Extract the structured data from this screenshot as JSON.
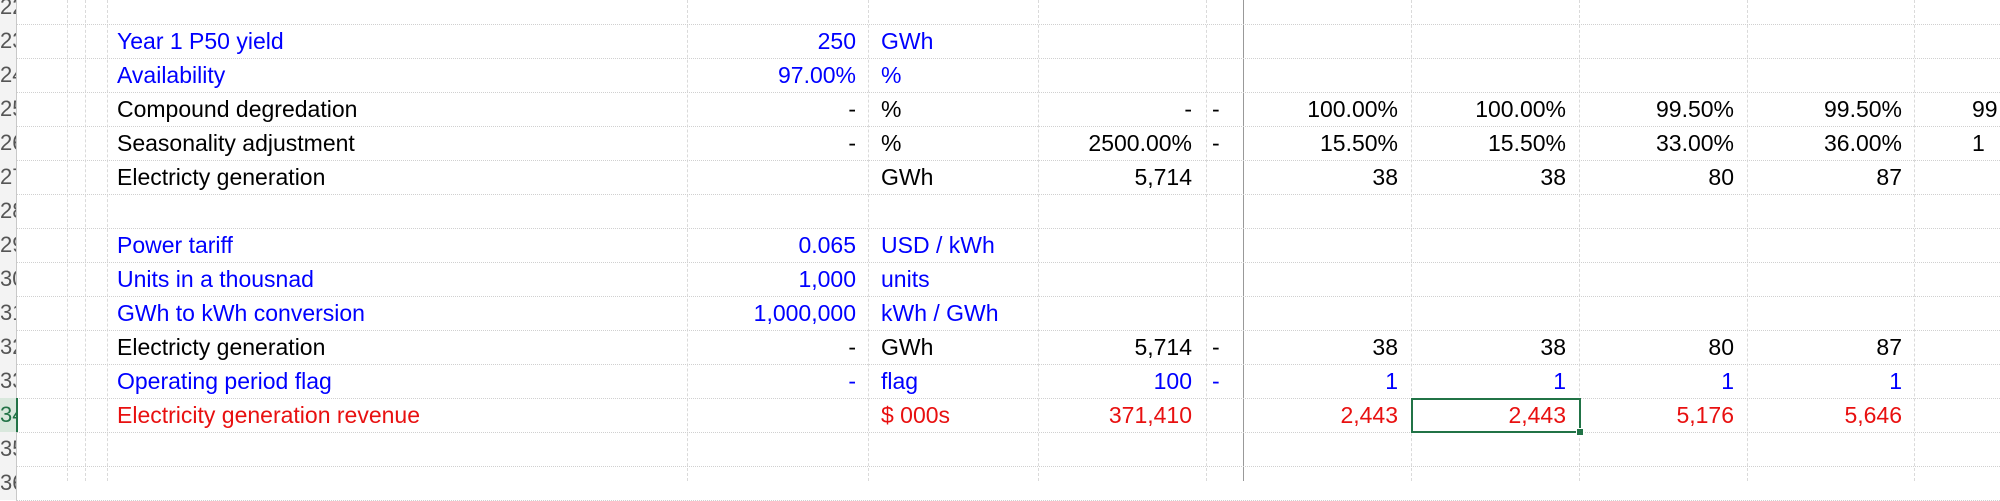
{
  "row_numbers": [
    "22",
    "23",
    "24",
    "25",
    "26",
    "27",
    "28",
    "29",
    "30",
    "31",
    "32",
    "33",
    "34",
    "35",
    "36"
  ],
  "active_row": "34",
  "rows": [
    {
      "row": "23",
      "color": "blue",
      "label": "Year 1 P50 yield",
      "value": "250",
      "unit": "GWh",
      "total": "",
      "flag": "",
      "periods": [
        "",
        "",
        "",
        ""
      ],
      "partial": ""
    },
    {
      "row": "24",
      "color": "blue",
      "label": "Availability",
      "value": "97.00%",
      "unit": "%",
      "total": "",
      "flag": "",
      "periods": [
        "",
        "",
        "",
        ""
      ],
      "partial": ""
    },
    {
      "row": "25",
      "color": "black",
      "label": "Compound degredation",
      "value": "-",
      "unit": "%",
      "total": "-",
      "flag": "-",
      "periods": [
        "100.00%",
        "100.00%",
        "99.50%",
        "99.50%"
      ],
      "partial": "99"
    },
    {
      "row": "26",
      "color": "black",
      "label": "Seasonality adjustment",
      "value": "-",
      "unit": "%",
      "total": "2500.00%",
      "flag": "-",
      "periods": [
        "15.50%",
        "15.50%",
        "33.00%",
        "36.00%"
      ],
      "partial": "1"
    },
    {
      "row": "27",
      "color": "black",
      "label": "Electricty generation",
      "value": "",
      "unit": "GWh",
      "total": "5,714",
      "flag": "",
      "periods": [
        "38",
        "38",
        "80",
        "87"
      ],
      "partial": ""
    },
    {
      "row": "29",
      "color": "blue",
      "label": "Power tariff",
      "value": "0.065",
      "unit": "USD / kWh",
      "total": "",
      "flag": "",
      "periods": [
        "",
        "",
        "",
        ""
      ],
      "partial": ""
    },
    {
      "row": "30",
      "color": "blue",
      "label": "Units in a thousnad",
      "value": "1,000",
      "unit": "units",
      "total": "",
      "flag": "",
      "periods": [
        "",
        "",
        "",
        ""
      ],
      "partial": ""
    },
    {
      "row": "31",
      "color": "blue",
      "label": "GWh to kWh conversion",
      "value": "1,000,000",
      "unit": "kWh / GWh",
      "total": "",
      "flag": "",
      "periods": [
        "",
        "",
        "",
        ""
      ],
      "partial": ""
    },
    {
      "row": "32",
      "color": "black",
      "label": "Electricty generation",
      "value": "-",
      "unit": "GWh",
      "total": "5,714",
      "flag": "-",
      "periods": [
        "38",
        "38",
        "80",
        "87"
      ],
      "partial": ""
    },
    {
      "row": "33",
      "color": "blue",
      "label": "Operating period flag",
      "value": "-",
      "unit": "flag",
      "total": "100",
      "flag": "-",
      "periods": [
        "1",
        "1",
        "1",
        "1"
      ],
      "partial": ""
    },
    {
      "row": "34",
      "color": "red",
      "label": "Electricity generation revenue",
      "value": "",
      "unit": "$ 000s",
      "total": "371,410",
      "flag": "",
      "periods": [
        "2,443",
        "2,443",
        "5,176",
        "5,646"
      ],
      "partial": ""
    }
  ],
  "colors": {
    "blue": "#0000ff",
    "red": "#e81010",
    "black": "#000000",
    "selection": "#217346"
  }
}
